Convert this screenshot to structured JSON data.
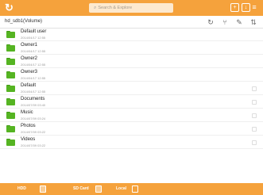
{
  "topbar": {
    "search_placeholder": "Search & Explore",
    "search_icon": "search-icon",
    "refresh_icon": "refresh-icon",
    "add_icon": "add-icon",
    "download_icon": "download-icon",
    "menu_icon": "menu-icon"
  },
  "pathbar": {
    "path": "hd_sdb1(Volume)",
    "tools": [
      "sync-icon",
      "share-icon",
      "edit-icon",
      "sort-icon"
    ]
  },
  "folders": [
    {
      "name": "Default user",
      "date": "2014/04/17 12:55"
    },
    {
      "name": "Owner1",
      "date": "2014/04/17 12:55"
    },
    {
      "name": "Owner2",
      "date": "2014/04/17 12:55"
    },
    {
      "name": "Owner3",
      "date": "2014/04/17 12:55"
    },
    {
      "name": "Default",
      "date": "2014/04/17 12:55"
    },
    {
      "name": "Documents",
      "date": "2014/07/09 03:40"
    },
    {
      "name": "Music",
      "date": "2014/07/09 03:24"
    },
    {
      "name": "Photos",
      "date": "2014/07/09 03:22"
    },
    {
      "name": "Videos",
      "date": "2014/07/09 03:22"
    }
  ],
  "bottombar": {
    "items": [
      {
        "label": "HDD",
        "icon": "hdd-icon"
      },
      {
        "label": "SD Card",
        "icon": "sd-card-icon"
      },
      {
        "label": "Local",
        "icon": "local-device-icon"
      }
    ]
  },
  "colors": {
    "accent": "#f5a23c",
    "folder": "#55b422"
  }
}
